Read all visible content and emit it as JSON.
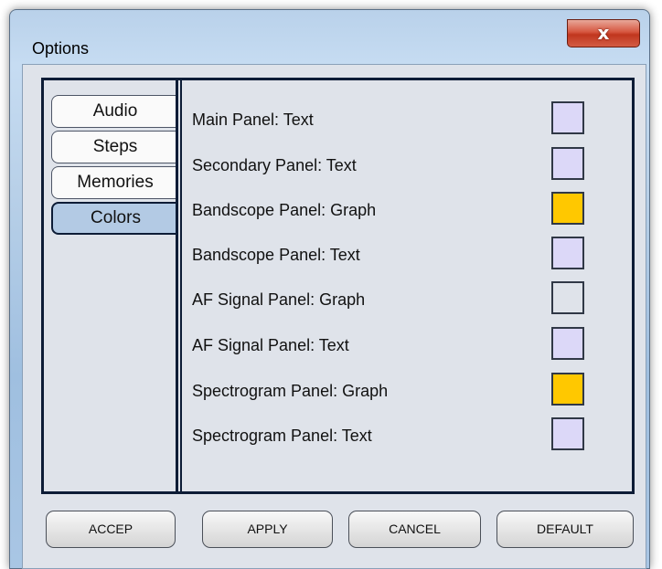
{
  "window": {
    "title": "Options",
    "close_glyph": "x"
  },
  "tabs": [
    {
      "label": "Audio",
      "active": false
    },
    {
      "label": "Steps",
      "active": false
    },
    {
      "label": "Memories",
      "active": false
    },
    {
      "label": "Colors",
      "active": true
    }
  ],
  "color_rows": [
    {
      "label": "Main Panel: Text",
      "color": "#dcd8f8"
    },
    {
      "label": "Secondary Panel: Text",
      "color": "#dcd8f8"
    },
    {
      "label": "Bandscope Panel: Graph",
      "color": "#ffc800"
    },
    {
      "label": "Bandscope Panel: Text",
      "color": "#dcd8f8"
    },
    {
      "label": "AF Signal Panel: Graph",
      "color": "#dfe3ea"
    },
    {
      "label": "AF Signal Panel: Text",
      "color": "#dcd8f8"
    },
    {
      "label": "Spectrogram Panel: Graph",
      "color": "#ffc800"
    },
    {
      "label": "Spectrogram Panel: Text",
      "color": "#dcd8f8"
    }
  ],
  "buttons": {
    "accept": "ACCEP",
    "apply": "APPLY",
    "cancel": "CANCEL",
    "default": "DEFAULT"
  }
}
